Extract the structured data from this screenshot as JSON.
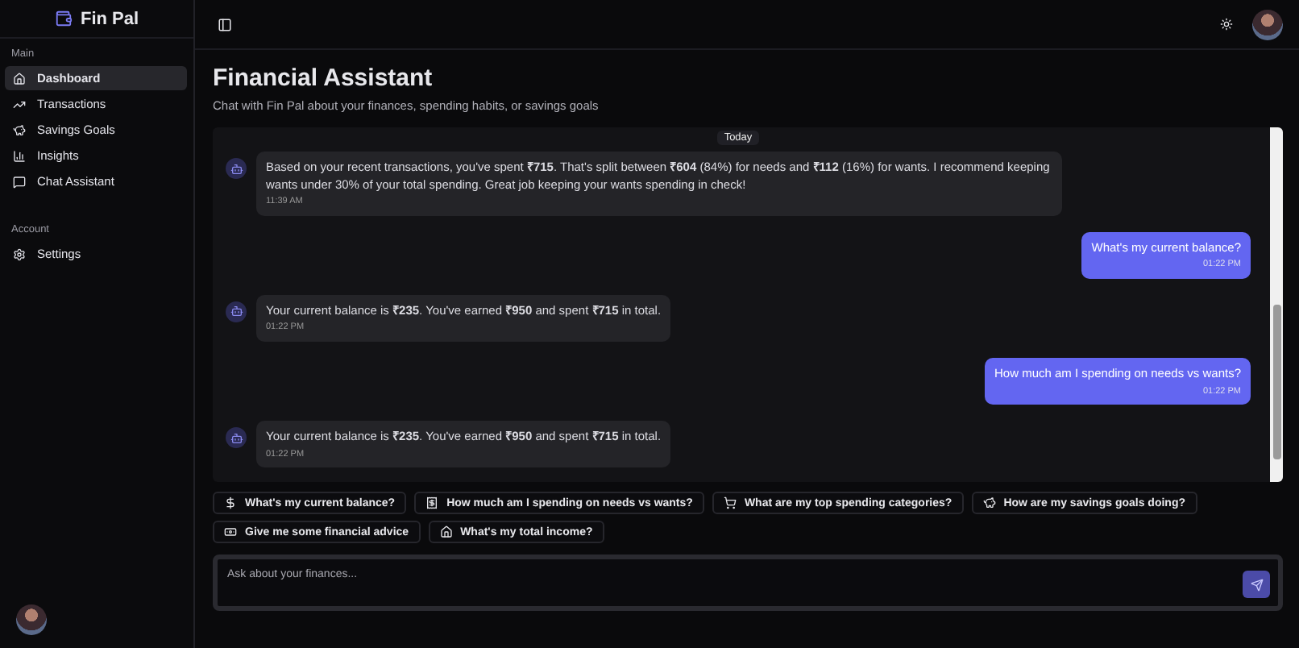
{
  "app": {
    "name": "Fin Pal"
  },
  "sidebar": {
    "sections": [
      {
        "title": "Main",
        "items": [
          {
            "label": "Dashboard",
            "selected": true
          },
          {
            "label": "Transactions",
            "selected": false
          },
          {
            "label": "Savings Goals",
            "selected": false
          },
          {
            "label": "Insights",
            "selected": false
          },
          {
            "label": "Chat Assistant",
            "selected": false
          }
        ]
      },
      {
        "title": "Account",
        "items": [
          {
            "label": "Settings",
            "selected": false
          }
        ]
      }
    ]
  },
  "page": {
    "title": "Financial Assistant",
    "subtitle": "Chat with Fin Pal about your finances, spending habits, or savings goals"
  },
  "chat": {
    "date_label": "Today",
    "messages": [
      {
        "kind": "bot",
        "text": "Based on your recent transactions, you've spent **₹715**. That's split between **₹604** (84%) for needs and **₹112** (16%) for wants. I recommend keeping wants under 30% of your total spending. Great job keeping your wants spending in check!",
        "time": "11:39 AM"
      },
      {
        "kind": "user",
        "text": "What's my current balance?",
        "time": "01:22 PM"
      },
      {
        "kind": "bot",
        "text": "Your current balance is **₹235**. You've earned **₹950** and spent **₹715** in total.",
        "time": "01:22 PM"
      },
      {
        "kind": "user",
        "text": "How much am I spending on needs vs wants?",
        "time": "01:22 PM"
      },
      {
        "kind": "bot",
        "text": "Your current balance is **₹235**. You've earned **₹950** and spent **₹715** in total.",
        "time": "01:22 PM"
      }
    ]
  },
  "suggestions": [
    {
      "label": "What's my current balance?"
    },
    {
      "label": "How much am I spending on needs vs wants?"
    },
    {
      "label": "What are my top spending categories?"
    },
    {
      "label": "How are my savings goals doing?"
    },
    {
      "label": "Give me some financial advice"
    },
    {
      "label": "What's my total income?"
    }
  ],
  "composer": {
    "placeholder": "Ask about your finances..."
  }
}
